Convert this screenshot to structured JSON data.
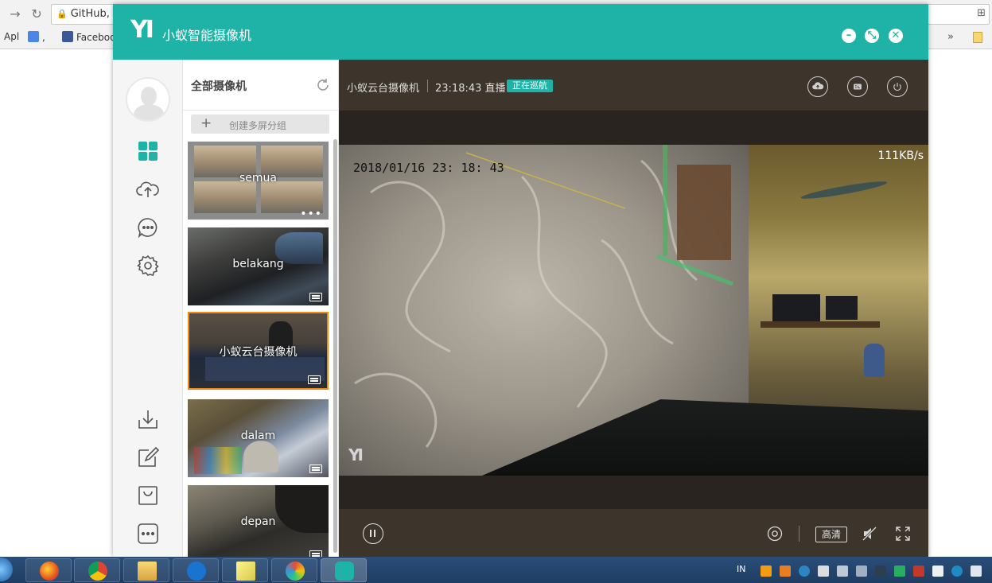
{
  "browser": {
    "tab_title": "GitHub, ",
    "bookmarks": [
      {
        "label": "Apl"
      },
      {
        "label": ","
      },
      {
        "label": "Faceboo"
      }
    ],
    "more": "»"
  },
  "app": {
    "logo": "YI",
    "title": "小蚁智能摄像机",
    "accent_color": "#1eb3a6",
    "window_buttons": [
      "minimize-icon",
      "restore-icon",
      "close-icon"
    ]
  },
  "sidebar": {
    "items": [
      {
        "icon": "grid-icon",
        "active": true
      },
      {
        "icon": "cloud-upload-icon"
      },
      {
        "icon": "chat-icon"
      },
      {
        "icon": "gear-icon"
      },
      {
        "icon": "download-icon"
      },
      {
        "icon": "edit-icon"
      },
      {
        "icon": "shopping-bag-icon"
      },
      {
        "icon": "more-icon"
      }
    ]
  },
  "camera_list": {
    "title": "全部摄像机",
    "create_group": "创建多屏分组",
    "cameras": [
      {
        "name": "semua"
      },
      {
        "name": "belakang"
      },
      {
        "name": "小蚁云台摄像机",
        "selected": true
      },
      {
        "name": "dalam"
      },
      {
        "name": "depan"
      }
    ]
  },
  "viewer": {
    "camera_name": "小蚁云台摄像机",
    "live_status": "23:18:43 直播",
    "patrol_badge": "正在巡航",
    "osd_datetime": "2018/01/16  23: 18: 43",
    "bitrate": "111KB/s",
    "osd_logo": "YI",
    "quality": "高清"
  },
  "taskbar": {
    "language": "IN"
  }
}
